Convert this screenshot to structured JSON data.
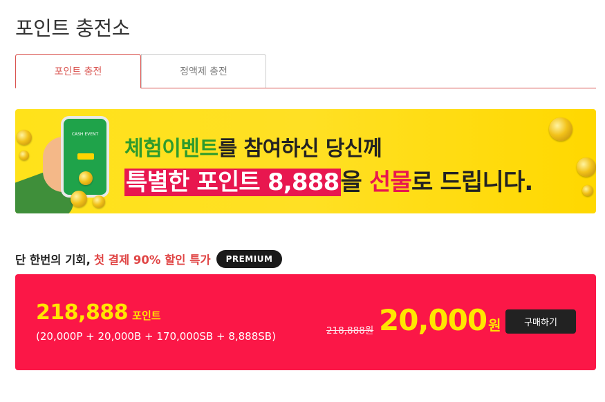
{
  "page": {
    "title": "포인트 충전소"
  },
  "tabs": [
    {
      "label": "포인트 충전",
      "active": true
    },
    {
      "label": "정액제 충전",
      "active": false
    }
  ],
  "banner": {
    "line1_green": "체험이벤트",
    "line1_rest": "를 참여하신 당신께",
    "line2_highlight": "특별한 포인트 8,888",
    "line2_mid": "을 ",
    "line2_red": "선물",
    "line2_end": "로 드립니다.",
    "phone_text": "CASH EVENT"
  },
  "promo": {
    "prefix": "단 한번의 기회,",
    "highlight": "첫 결제 90% 할인 특가",
    "badge": "PREMIUM"
  },
  "product": {
    "points": "218,888",
    "points_unit": "포인트",
    "breakdown": "(20,000P + 20,000B + 170,000SB + 8,888SB)",
    "original_price": "218,888원",
    "sale_price": "20,000",
    "currency": "원",
    "buy_label": "구매하기"
  },
  "colors": {
    "accent_red": "#d9534f",
    "card_bg": "#fb1747",
    "price_yellow": "#ffe600",
    "banner_yellow": "#ffe21a",
    "banner_highlight": "#e8174f",
    "banner_green": "#2d9b2d"
  }
}
